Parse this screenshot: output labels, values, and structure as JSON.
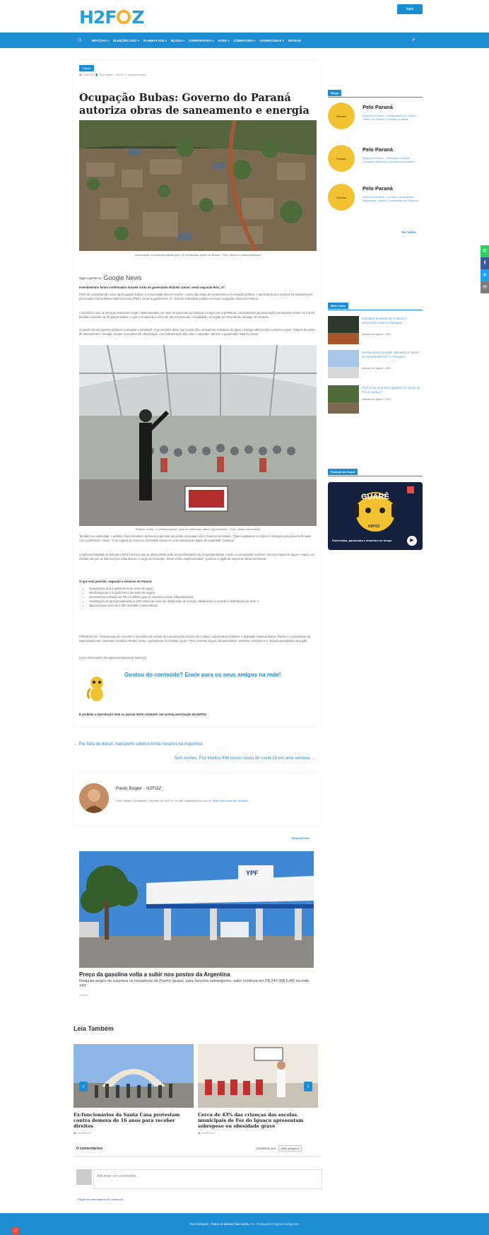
{
  "header": {
    "logo": "H2FOZ",
    "login": "login"
  },
  "nav": {
    "items": [
      "NOTÍCIAS ▾",
      "ELEIÇÕES 2022 ▾",
      "PLANETA FOZ ▾",
      "BLOGS ▾",
      "CORPORATIVO ▾",
      "SITES ▾",
      "COBERTURA ▾",
      "ASSINATURAS ▾",
      "ENTRAR"
    ]
  },
  "article": {
    "category": "Cidade",
    "meta": "▣ 27/06/2022   👤 Paulo Bogler – H2FOZ   ✎ ocupação bubas",
    "title": "Ocupação Bubas: Governo do Paraná autoriza obras de saneamento e energia",
    "caption1": "Associação comunitária estima que 1,8 mil famílias vivem no Bubas - Foto: Marcos Labanca/Arquivo",
    "gnews_prefix": "Siga o gente no",
    "gnews_brand": "Google News",
    "lead": "Investimentos foram confirmados durante visita do governador Ratinho Junior, nesta segunda-feira, 27.",
    "p1": "Perto de completar dez anos da Ocupação Bubas, a comunidade deverá receber o início das obras de saneamento e iluminação pública. A autorização dos serviços foi assinada pelo governador Carlos Massa Ratinho Junior (PSD), nesta segunda-feira, 27, durante solenidade pública na maior ocupação urbana do Paraná.",
    "p2": "A previsão é que os serviços essenciais sejam implementados por meio de parcerias da Sanepar e Copel com a prefeitura. Levantamento da associação comunitária estima em 1,8 mil famílias morando na Ocupação Bubas, o que corresponde a cerca de dez mil pessoas. A localidade, na região do Porto Meira, abrange 40 hectares.",
    "p3": "O evento reuniu agentes públicos municipais e estaduais. O governador disse que a ação das companhias estaduais de água e energia elétrica são o primeiro passo. \"Depois do ponto de saneamento e energia, iniciam os projetos de urbanização, com estruturação das ruas e calçadas\", afirmou o governador Ratinho Junior.",
    "caption2": "Ratinho Junior: o \"primeiro passo\" para as melhorias, disse o governador – Foto: Gilson Abreu/AEN",
    "p4": "Também na solenidade, o prefeito Chico Brasileiro destacou a parceria da gestão municipal com o Governo do Estado. \"Quero agradecer a Copel e à Sanepar pela parceria firmada com a prefeitura\", disse. \"Com a ajuda do Governo do Estado vamos ter uma urbanização digna, de qualidade\", pontuou.",
    "p5": "A Agência Estadual de Notícias (AEN) informou que as obras obedecerão às peculiaridades da Ocupação Bubas. Assim, a comunidade receberá \"serviço regular de água e esgoto, na medida em que as intervenções urbanísticas, a cargo do município, forem sendo implementadas\", pontuou o órgão de imprensa oficial do Paraná.",
    "list_head": "O que está previsto, segundo o Governo do Paraná:",
    "bullets": [
      "implantação de 8,2 quilômetros de redes de água;",
      "eletrificação de 6,9 quilômetros de redes de esgoto;",
      "investimento estimado de R$ 1,6 milhão (que se somará a outras infraestruturas);",
      "implantação de aproximadamente 6.100 metros de redes de distribuição de energia, viabilizando a conexão e distribuição da rede, e",
      "ligações para cerca de 1.500 unidades consumidoras."
    ],
    "p6": "PRESENÇAS – Participaram do encontro o secretário de estado da Comunicação Social e da Cultura, João Evaristo Debiasi; o deputado estadual Márcio Pacheco; o presidente da Itaipu Binacional, Almirante Anatalício Risden Junior; o presidente do Instituto Água e Terra, Everton Souza; Eduardo Bekin, prefeitos, vereadores e demais autoridades da região.",
    "p7": "(Com informações da Agência Estadual de Notícias)",
    "share": "Gostou do conteúdo? Envie para os seus amigos na rede!",
    "prohib": "É proibida a reprodução total ou parcial deste conteúdo sem prévia autorização do H2FOZ."
  },
  "pagination": {
    "prev": "← Por falta de diesel, transporte coletivo limita horários na Argentina",
    "next": "Sem mortes, Foz totaliza 406 novos casos de covid-19 em uma semana →"
  },
  "author": {
    "name": "Paulo Bogler - H2FOZ",
    "bio": "Paulo Bogler é jornalista e repórter do H2FOZ. e-mail: bogler@h2foz.com.br",
    "bio_link": "Veja mais conteúdo do autor"
  },
  "sponsored": {
    "tag": "Taboola Feed",
    "title": "Preço da gasolina volta a subir nos postos da Argentina",
    "desc": "Reajuste pegou de surpresa os moradores de Puerto Iguazú, para veículos estrangeiros, valor continua em P$ 240 (R$ 6,40) na rede YPF",
    "src": "H2Foz"
  },
  "leia": {
    "heading": "Leia Também",
    "cards": [
      {
        "title": "Ex-funcionários da Santa Casa protestam contra demora de 16 anos para receber direitos",
        "date": "▣ 02/08/2022"
      },
      {
        "title": "Cerca de 43% das crianças das escolas municipais de Foz do Iguaçu apresentam sobrepeso ou obesidade grave",
        "date": "▣ 02/08/2022"
      }
    ]
  },
  "comments": {
    "count": "0 comentários",
    "sort_label": "Classificar por",
    "sort_value": "Mais antigos ▾",
    "placeholder": "Adicionar um comentário...",
    "fb": "Plugin de comentários do Facebook"
  },
  "sidebar": {
    "blogs_head": "Blogs",
    "blogs": [
      {
        "logo": "Paraná",
        "title": "Pelo Paraná",
        "desc": "Blog pelo Paraná - Mangabeira em Tóquio; \"Bicho do Paraná\" é Estado a visitar"
      },
      {
        "logo": "Paraná",
        "title": "Pelo Paraná",
        "desc": "Blog pelo Paraná - Mercados Globais: Comissão especial e Apucará economia?!"
      },
      {
        "logo": "Paraná",
        "title": "Pelo Paraná",
        "desc": "Blog pelo Paraná - Corrida à presidência. Segurança, saúde e Candidatos ao Governo"
      }
    ],
    "ver_todos": "Ver todos",
    "mais_head": "Mais Lidos",
    "mais": [
      {
        "title": "Estudante brasileiro de medicina é encontrado morto no Paraguai",
        "date": "publicado em agosto 1, 2022"
      },
      {
        "title": "Família denuncia golpe aplicado por \"gestor de estacionamento\" no Paraguai",
        "date": "publicado em agosto 1, 2022"
      },
      {
        "title": "Você já viu as árvores gigantes no centro de Foz do Iguaçu?",
        "date": "publicado em agosto 1, 2022"
      }
    ],
    "podcast_head": "Podcast do Guarê",
    "podcast_brand": "GUARÊ",
    "podcast_sub": "H2FOZ",
    "podcast_text": "Entrevistas, jabuticaba e sinônimo de tempo"
  },
  "social": [
    "✆",
    "f",
    "✈",
    "✉"
  ],
  "footer": {
    "text": "Foz Avançado - Todos os direitos reservados.",
    "link": "H2 - Publicações Digitais Inteligentes"
  }
}
